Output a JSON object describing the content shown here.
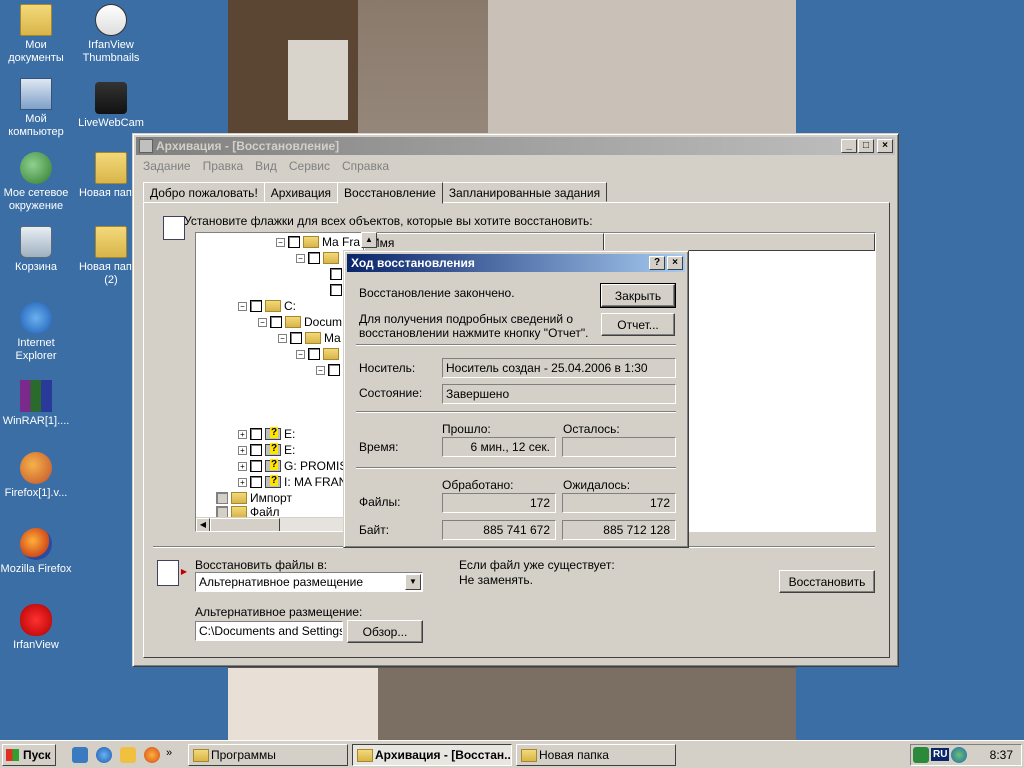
{
  "desktop": {
    "icons": [
      {
        "label": "Мои документы",
        "icon": "folder-icon"
      },
      {
        "label": "IrfanView Thumbnails",
        "icon": "panda-icon"
      },
      {
        "label": "Мой компьютер",
        "icon": "computer-icon"
      },
      {
        "label": "LiveWebCam",
        "icon": "camera-icon"
      },
      {
        "label": "Мое сетевое окружение",
        "icon": "network-icon"
      },
      {
        "label": "Новая папка",
        "icon": "folder-icon"
      },
      {
        "label": "Корзина",
        "icon": "recycle-bin-icon"
      },
      {
        "label": "Новая папка (2)",
        "icon": "folder-icon"
      },
      {
        "label": "Internet Explorer",
        "icon": "ie-icon"
      },
      {
        "label": "WinRAR[1]....",
        "icon": "winrar-icon"
      },
      {
        "label": "Firefox[1].v...",
        "icon": "firefox-installer-icon"
      },
      {
        "label": "Mozilla Firefox",
        "icon": "firefox-icon"
      },
      {
        "label": "IrfanView",
        "icon": "irfanview-icon"
      }
    ]
  },
  "window": {
    "title": "Архивация - [Восстановление]",
    "menu": [
      "Задание",
      "Правка",
      "Вид",
      "Сервис",
      "Справка"
    ],
    "tabs": [
      "Добро пожаловать!",
      "Архивация",
      "Восстановление",
      "Запланированные задания"
    ],
    "active_tab": 2,
    "hint": "Установите флажки для всех объектов, которые вы хотите восстановить:",
    "tree": [
      "Ma Fra",
      "C:",
      "Docum",
      "Ma",
      "E:",
      "E:",
      "G: PROMIS",
      "I: MA FRAN",
      "Импорт",
      "Файл"
    ],
    "list_header": "Имя",
    "restore_to_label": "Восстановить файлы в:",
    "restore_to_value": "Альтернативное размещение",
    "alt_location_label": "Альтернативное размещение:",
    "alt_location_value": "C:\\Documents and Settings\\A",
    "browse_button": "Обзор...",
    "if_exists_label": "Если файл уже существует:",
    "if_exists_value": "Не заменять.",
    "restore_button": "Восстановить"
  },
  "dialog": {
    "title": "Ход восстановления",
    "status_text": "Восстановление закончено.",
    "close_button": "Закрыть",
    "report_hint": "Для получения подробных сведений о восстановлении нажмите кнопку \"Отчет\".",
    "report_button": "Отчет...",
    "media_label": "Носитель:",
    "media_value": "Носитель создан - 25.04.2006 в 1:30",
    "state_label": "Состояние:",
    "state_value": "Завершено",
    "elapsed_label": "Прошло:",
    "remaining_label": "Осталось:",
    "time_label": "Время:",
    "elapsed_value": "6 мин., 12 сек.",
    "remaining_value": "",
    "processed_label": "Обработано:",
    "expected_label": "Ожидалось:",
    "files_label": "Файлы:",
    "files_processed": "172",
    "files_expected": "172",
    "bytes_label": "Байт:",
    "bytes_processed": "885 741 672",
    "bytes_expected": "885 712 128"
  },
  "taskbar": {
    "start": "Пуск",
    "tasks": [
      "Программы",
      "Архивация - [Восстан...",
      "Новая папка"
    ],
    "active_task": 1,
    "lang": "RU",
    "clock": "8:37"
  }
}
